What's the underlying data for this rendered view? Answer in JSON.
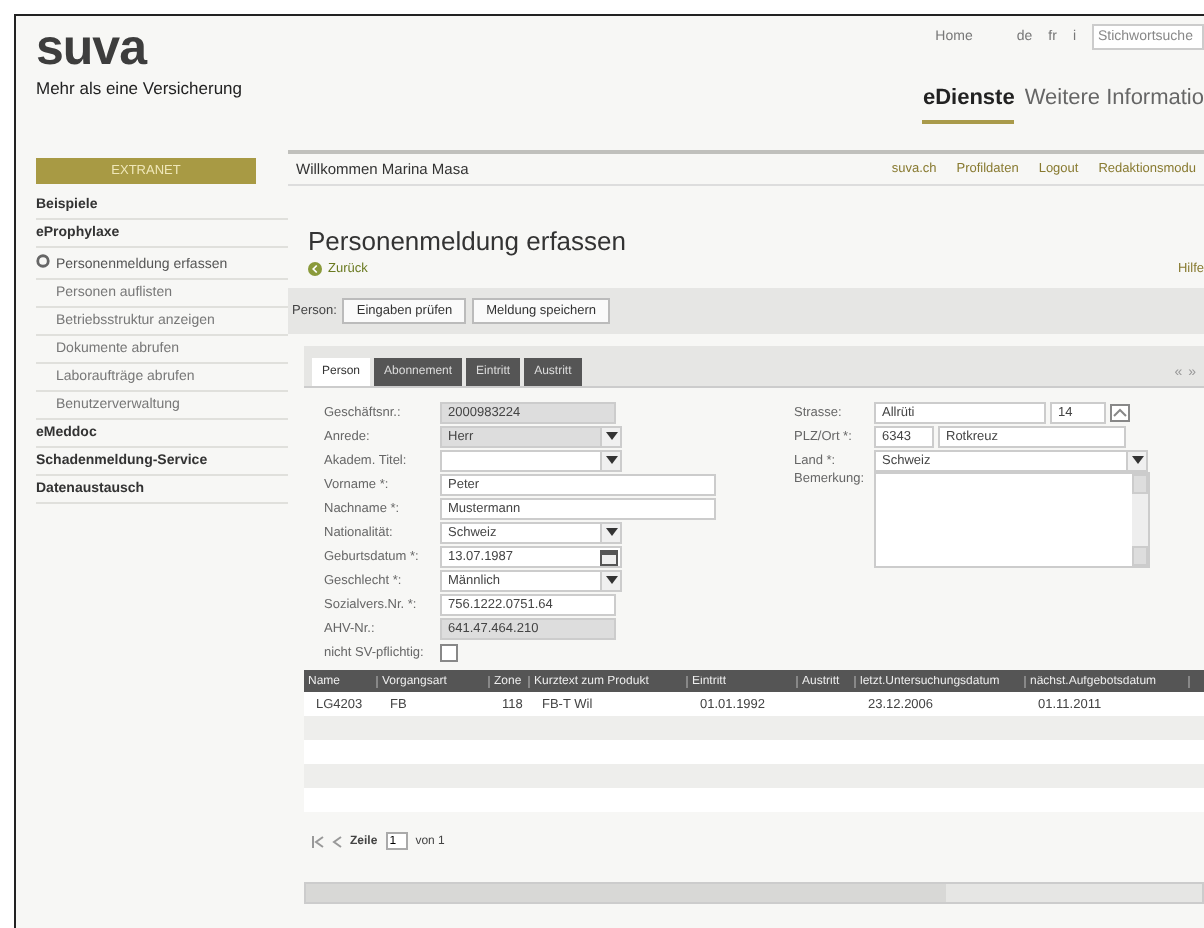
{
  "header": {
    "logo": "suva",
    "tagline": "Mehr als eine Versicherung",
    "top_links": [
      "Home",
      "de",
      "fr",
      "i"
    ],
    "search": {
      "placeholder": "Stichwortsuche"
    },
    "nav": [
      {
        "label": "eDienste",
        "selected": true
      },
      {
        "label": "Weitere Informatio",
        "selected": false
      }
    ]
  },
  "extranet_button": "EXTRANET",
  "welcome": "Willkommen Marina Masa",
  "user_links": [
    "suva.ch",
    "Profildaten",
    "Logout",
    "Redaktionsmodu"
  ],
  "sidebar": [
    {
      "label": "Beispiele",
      "kind": "section",
      "selected": false
    },
    {
      "label": "eProphylaxe",
      "kind": "section",
      "selected": false
    },
    {
      "label": "Personenmeldung erfassen",
      "kind": "item",
      "selected": true
    },
    {
      "label": "Personen auflisten",
      "kind": "item",
      "selected": false
    },
    {
      "label": "Betriebsstruktur anzeigen",
      "kind": "item",
      "selected": false
    },
    {
      "label": "Dokumente abrufen",
      "kind": "item",
      "selected": false
    },
    {
      "label": "Laboraufträge abrufen",
      "kind": "item",
      "selected": false
    },
    {
      "label": "Benutzerverwaltung",
      "kind": "item",
      "selected": false
    },
    {
      "label": "eMeddoc",
      "kind": "section",
      "selected": false
    },
    {
      "label": "Schadenmeldung-Service",
      "kind": "section",
      "selected": false
    },
    {
      "label": "Datenaustausch",
      "kind": "section",
      "selected": false
    }
  ],
  "page_title": "Personenmeldung erfassen",
  "back_link": "Zurück",
  "help_link": "Hilfe",
  "toolbar": {
    "label": "Person:",
    "buttons": [
      "Eingaben prüfen",
      "Meldung speichern"
    ]
  },
  "tabs": [
    {
      "label": "Person",
      "selected": true
    },
    {
      "label": "Abonnement",
      "selected": false
    },
    {
      "label": "Eintritt",
      "selected": false
    },
    {
      "label": "Austritt",
      "selected": false
    }
  ],
  "tab_scroll": [
    "«",
    "»"
  ],
  "form_left": [
    {
      "label": "Geschäftsnr.:",
      "kind": "text",
      "value": "2000983224",
      "disabled": true,
      "wide": false
    },
    {
      "label": "Anrede:",
      "kind": "select",
      "value": "Herr",
      "disabled": true
    },
    {
      "label": "Akadem. Titel:",
      "kind": "select",
      "disabled": false
    },
    {
      "label": "Vorname *:",
      "kind": "text",
      "value": "Peter",
      "disabled": false,
      "wide": true
    },
    {
      "label": "Nachname *:",
      "kind": "text",
      "value": "Mustermann",
      "disabled": false,
      "wide": true
    },
    {
      "label": "Nationalität:",
      "kind": "select",
      "value": "Schweiz",
      "disabled": false
    },
    {
      "label": "Geburtsdatum *:",
      "kind": "date",
      "value": "13.07.1987",
      "disabled": false
    },
    {
      "label": "Geschlecht *:",
      "kind": "select",
      "value": "Männlich",
      "disabled": false
    },
    {
      "label": "Sozialvers.Nr. *:",
      "kind": "text",
      "value": "756.1222.0751.64",
      "disabled": false,
      "wide": false
    },
    {
      "label": "AHV-Nr.:",
      "kind": "text",
      "value": "641.47.464.210",
      "disabled": true,
      "wide": false
    },
    {
      "label": "nicht SV-pflichtig:",
      "kind": "checkbox",
      "checked": false
    }
  ],
  "address": {
    "street_label": "Strasse:",
    "street": "Allrüti",
    "house_no": "14",
    "plz_label": "PLZ/Ort *:",
    "plz": "6343",
    "city": "Rotkreuz",
    "country_label": "Land *:",
    "country": "Schweiz",
    "remark_label": "Bemerkung:"
  },
  "table": {
    "columns": [
      "Name",
      "Vorgangsart",
      "Zone",
      "Kurztext zum Produkt",
      "Eintritt",
      "Austritt",
      "letzt.Untersuchungsdatum",
      "nächst.Aufgebotsdatum"
    ],
    "rows": [
      [
        "LG4203",
        "FB",
        "118",
        "FB-T Wil",
        "01.01.1992",
        "",
        "23.12.2006",
        "01.11.2011"
      ]
    ]
  },
  "pager": {
    "page_label": "Zeile",
    "page": "1",
    "of": "von 1"
  }
}
